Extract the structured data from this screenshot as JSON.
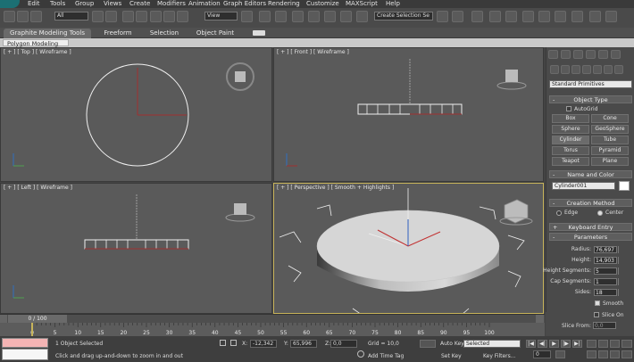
{
  "menu": [
    "Edit",
    "Tools",
    "Group",
    "Views",
    "Create",
    "Modifiers",
    "Animation",
    "Graph Editors",
    "Rendering",
    "Customize",
    "MAXScript",
    "Help"
  ],
  "toolbar": {
    "filter_value": "All",
    "refcoord_value": "View",
    "selection_set_placeholder": "Create Selection Se"
  },
  "ribbon": {
    "tabs": [
      "Graphite Modeling Tools",
      "Freeform",
      "Selection",
      "Object Paint"
    ],
    "subtab": "Polygon Modeling"
  },
  "viewports": {
    "top": "[ + ] [ Top ] [ Wireframe ]",
    "front": "[ + ] [ Front ] [ Wireframe ]",
    "left": "[ + ] [ Left ] [ Wireframe ]",
    "perspective": "[ + ] [ Perspective ] [ Smooth + Highlights ]"
  },
  "command_panel": {
    "category": "Standard Primitives",
    "object_type_title": "Object Type",
    "autogrid": "AutoGrid",
    "buttons": [
      "Box",
      "Cone",
      "Sphere",
      "GeoSphere",
      "Cylinder",
      "Tube",
      "Torus",
      "Pyramid",
      "Teapot",
      "Plane"
    ],
    "name_color_title": "Name and Color",
    "object_name": "Cylinder001",
    "object_color": "#ffffff",
    "creation_method_title": "Creation Method",
    "creation_methods": [
      "Edge",
      "Center"
    ],
    "creation_method_selected": "Center",
    "keyboard_entry_title": "Keyboard Entry",
    "parameters_title": "Parameters",
    "params": [
      {
        "label": "Radius:",
        "value": "76,697"
      },
      {
        "label": "Height:",
        "value": "14,903"
      },
      {
        "label": "Height Segments:",
        "value": "5"
      },
      {
        "label": "Cap Segments:",
        "value": "1"
      },
      {
        "label": "Sides:",
        "value": "18"
      }
    ],
    "smooth": {
      "label": "Smooth",
      "checked": true
    },
    "slice_on": {
      "label": "Slice On",
      "checked": false
    },
    "slice_from": {
      "label": "Slice From:",
      "value": "0,0"
    }
  },
  "timeline": {
    "frame_counter": "0 / 100",
    "ticks": [
      "0",
      "5",
      "10",
      "15",
      "20",
      "25",
      "30",
      "35",
      "40",
      "45",
      "50",
      "55",
      "60",
      "65",
      "70",
      "75",
      "80",
      "85",
      "90",
      "95",
      "100"
    ]
  },
  "status": {
    "selected": "1 Object Selected",
    "prompt": "Click and drag up-and-down to zoom in and out",
    "x_label": "X:",
    "x_value": "-12,342",
    "y_label": "Y:",
    "y_value": "65,996",
    "z_label": "Z:",
    "z_value": "0,0",
    "grid": "Grid = 10,0",
    "add_time_tag": "Add Time Tag",
    "auto_key": "Auto Key",
    "set_key": "Set Key",
    "key_mode": "Selected",
    "key_filters": "Key Filters...",
    "current_frame": "0"
  },
  "colors": {
    "accent_active_viewport": "#c8b45a",
    "logo": "#1c6f73",
    "status_swatch": "#f4b4b4"
  }
}
